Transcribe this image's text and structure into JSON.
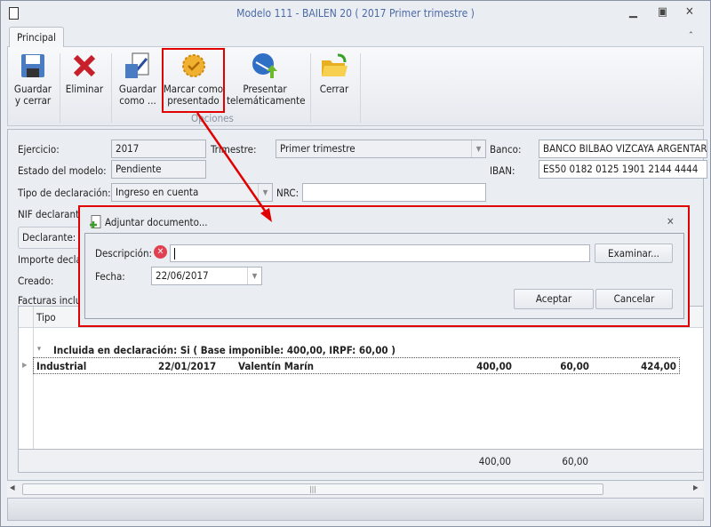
{
  "window": {
    "title": "Modelo 111 - BAILEN 20 ( 2017 Primer trimestre )"
  },
  "tabs": [
    {
      "label": "Principal"
    }
  ],
  "ribbon": {
    "buttons": [
      {
        "label1": "Guardar",
        "label2": "y cerrar",
        "icon": "floppy-disk-icon"
      },
      {
        "label1": "Eliminar",
        "label2": "",
        "icon": "red-x-icon"
      },
      {
        "label1": "Guardar",
        "label2": "como ...",
        "icon": "save-as-icon"
      },
      {
        "label1": "Marcar como",
        "label2": "presentado",
        "icon": "seal-check-icon"
      },
      {
        "label1": "Presentar",
        "label2": "telemáticamente",
        "icon": "globe-upload-icon"
      },
      {
        "label1": "Cerrar",
        "label2": "",
        "icon": "folder-open-icon"
      }
    ],
    "group_label": "Opciones"
  },
  "form": {
    "ejercicio_label": "Ejercicio:",
    "ejercicio": "2017",
    "trimestre_label": "Trimestre:",
    "trimestre": "Primer trimestre",
    "banco_label": "Banco:",
    "banco": "BANCO BILBAO VIZCAYA ARGENTARIA",
    "estado_label": "Estado del modelo:",
    "estado": "Pendiente",
    "iban_label": "IBAN:",
    "iban": "ES50 0182 0125 1901 2144 4444",
    "tipo_label": "Tipo de declaración:",
    "tipo": "Ingreso en cuenta",
    "nrc_label": "NRC:",
    "nrc": "",
    "nif_label": "NIF declarante",
    "declarante_label": "Declarante:",
    "importe_label": "Importe declar",
    "creado_label": "Creado:",
    "facturas_label": "Facturas inclui"
  },
  "grid": {
    "header_tipo": "Tipo",
    "group_row": "Incluida en declaración: Si ( Base imponible: 400,00,  IRPF: 60,00 )",
    "rows": [
      {
        "tipo": "Industrial",
        "fecha": "22/01/2017",
        "nombre": "Valentín Marín",
        "base": "400,00",
        "irpf": "60,00",
        "total": "424,00"
      }
    ],
    "footer": {
      "base": "400,00",
      "irpf": "60,00"
    }
  },
  "dialog": {
    "title": "Adjuntar documento...",
    "descripcion_label": "Descripción:",
    "descripcion": "",
    "examinar": "Examinar...",
    "fecha_label": "Fecha:",
    "fecha": "22/06/2017",
    "aceptar": "Aceptar",
    "cancelar": "Cancelar"
  },
  "colors": {
    "highlight": "#e00000",
    "title": "#4c6aa8"
  }
}
